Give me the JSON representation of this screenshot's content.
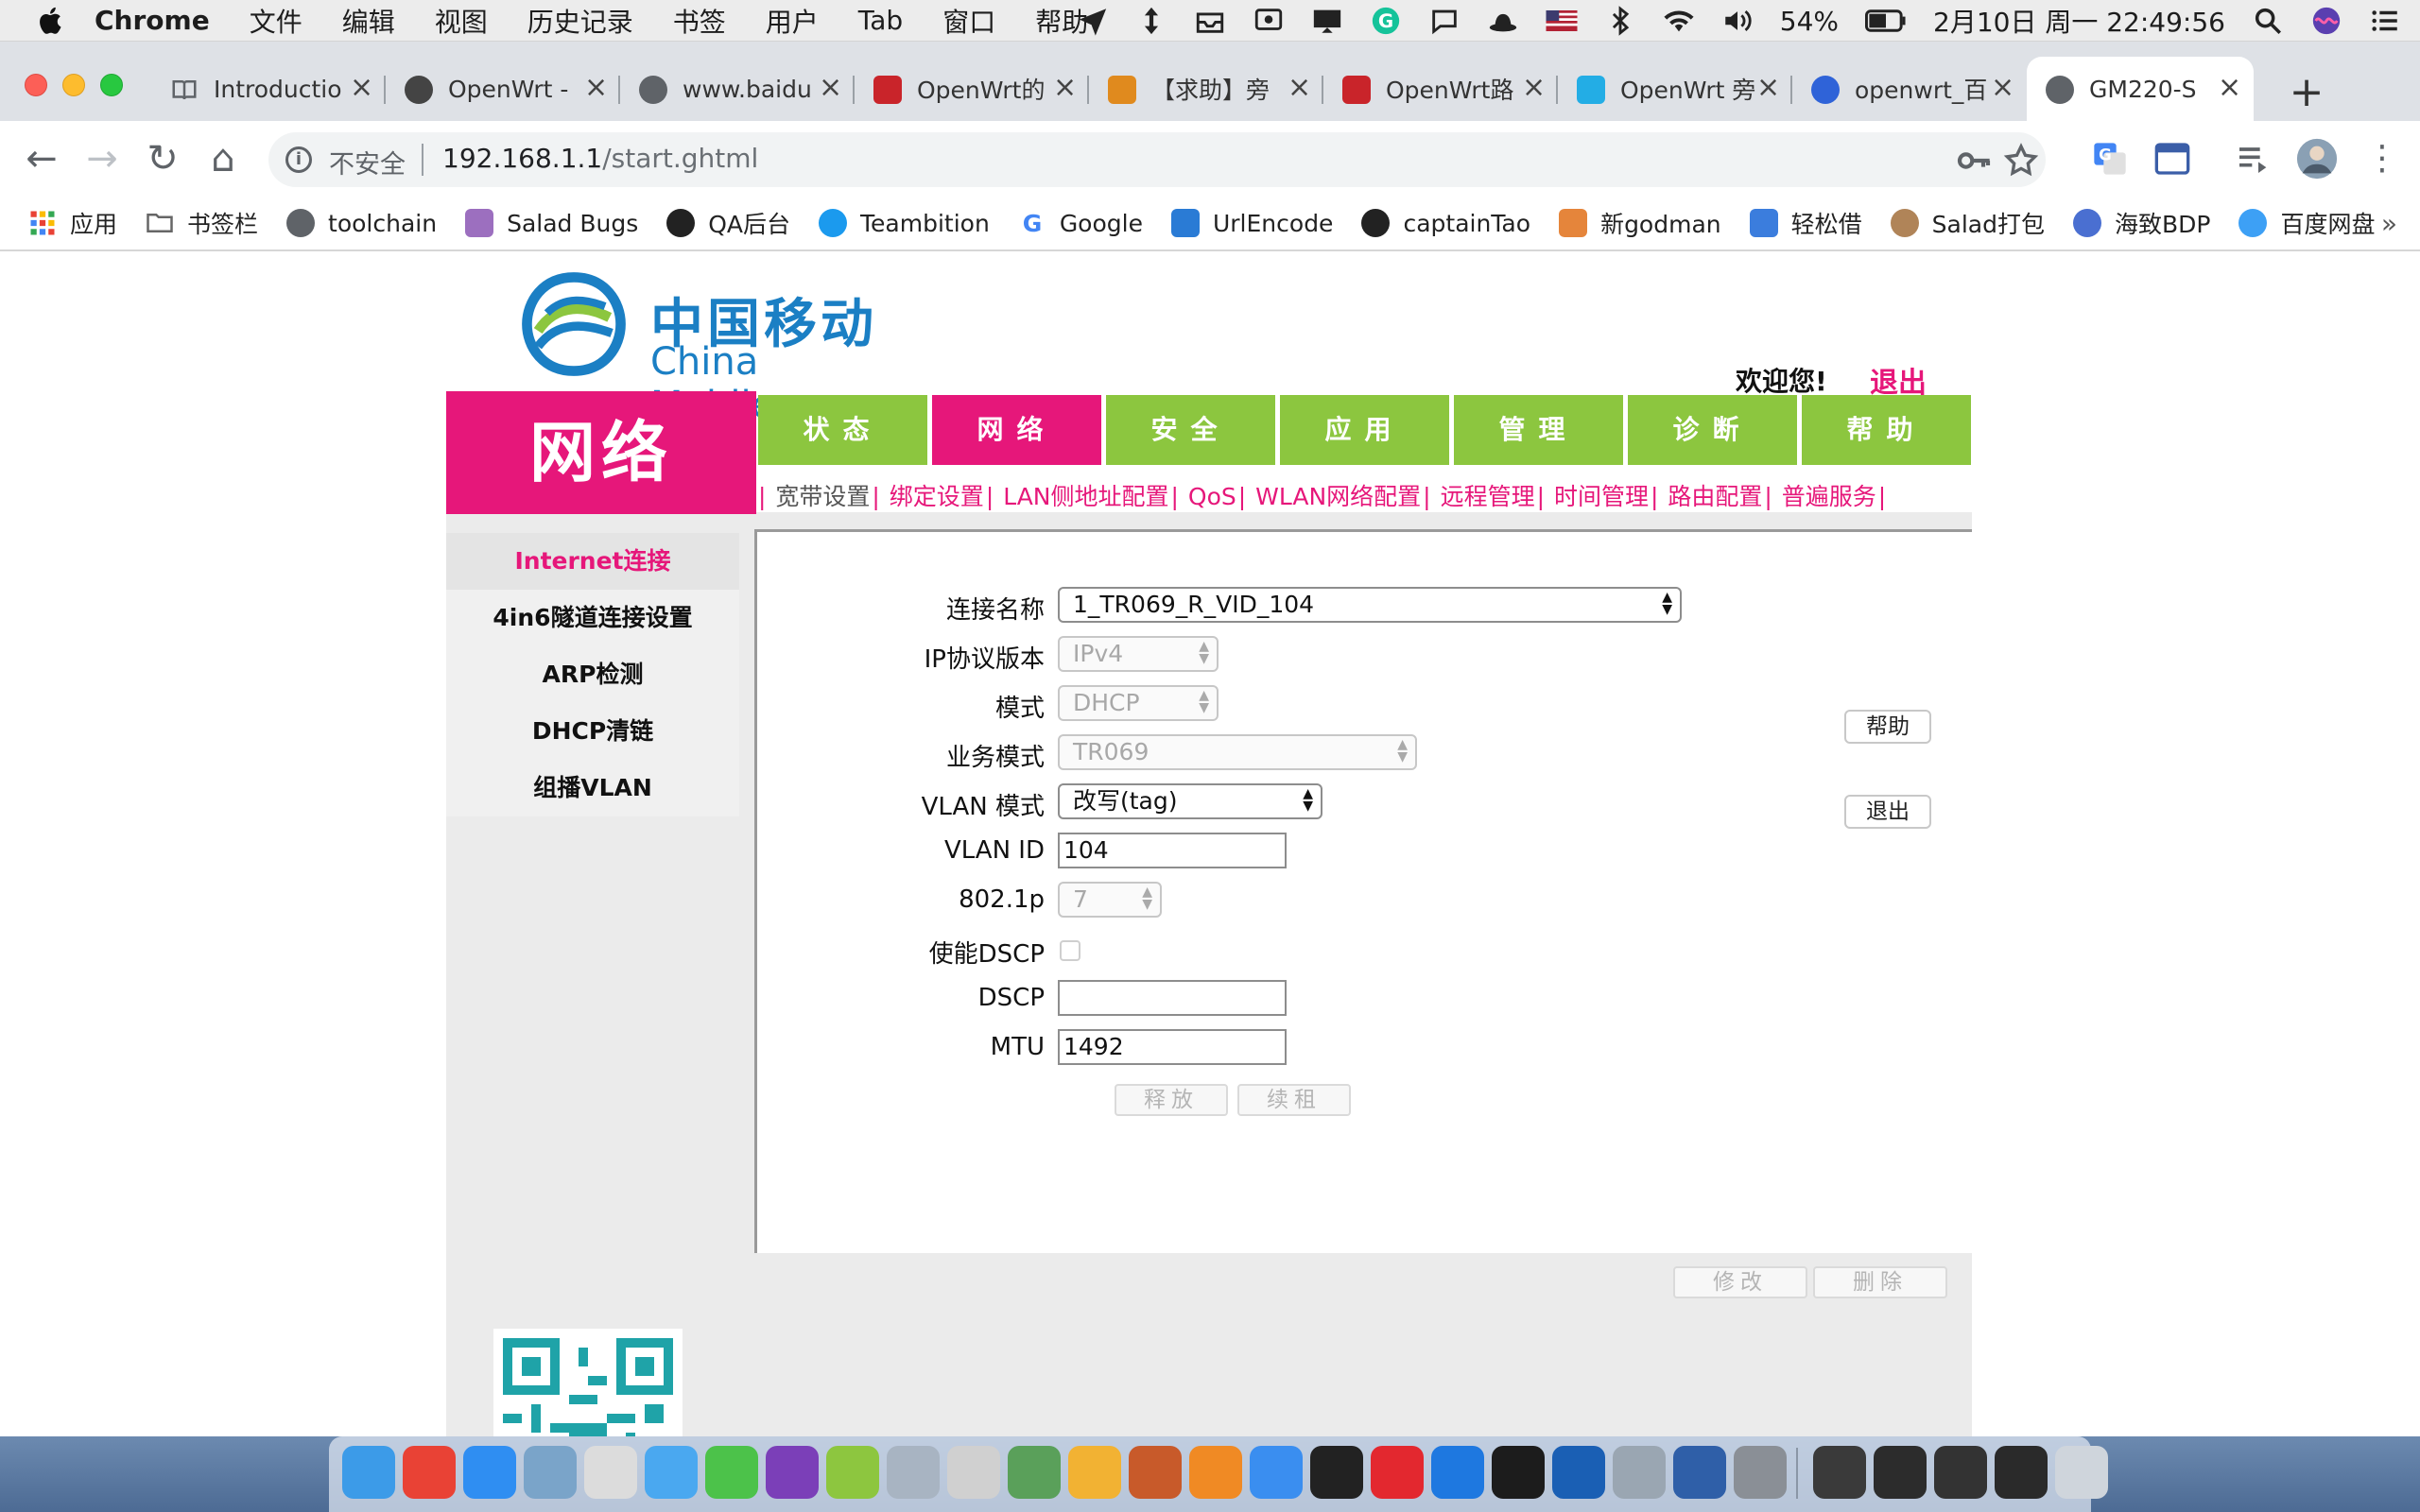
{
  "menubar": {
    "app_name": "Chrome",
    "menus": [
      "文件",
      "编辑",
      "视图",
      "历史记录",
      "书签",
      "用户",
      "Tab",
      "窗口",
      "帮助"
    ],
    "battery": "54%",
    "datetime": "2月10日 周一  22:49:56",
    "status_icons": [
      "send-icon",
      "updown-arrow-icon",
      "inbox-icon",
      "screenshot-icon",
      "screen-mirror-icon",
      "grammarly-icon",
      "chat-icon",
      "hat-icon",
      "us-flag-icon",
      "bluetooth-icon",
      "wifi-icon",
      "volume-icon",
      "battery-icon",
      "spotlight-icon",
      "siri-icon",
      "notification-list-icon"
    ]
  },
  "tabs": [
    {
      "title": "Introductio",
      "icon": "book-icon",
      "color": "#5f6368"
    },
    {
      "title": "OpenWrt -",
      "icon": "openwrt-icon",
      "color": "#444444"
    },
    {
      "title": "www.baidu",
      "icon": "globe-icon",
      "color": "#5f6368"
    },
    {
      "title": "OpenWrt的",
      "icon": "csdn-icon",
      "color": "#c9242a"
    },
    {
      "title": "【求助】旁",
      "icon": "forum-icon",
      "color": "#e08a1e"
    },
    {
      "title": "OpenWrt路",
      "icon": "csdn-icon",
      "color": "#c9242a"
    },
    {
      "title": "OpenWrt 旁",
      "icon": "bilibili-icon",
      "color": "#23ade5"
    },
    {
      "title": "openwrt_百",
      "icon": "baidu-paw-icon",
      "color": "#2f63d8"
    },
    {
      "title": "GM220-S",
      "icon": "globe-icon",
      "color": "#5f6368",
      "active": true
    }
  ],
  "address": {
    "security_text": "不安全",
    "url_host": "192.168.1.1",
    "url_path": "/start.ghtml"
  },
  "bookmarks": [
    {
      "label": "应用",
      "icon": "apps-grid-icon",
      "color": "#e94235"
    },
    {
      "label": "书签栏",
      "icon": "folder-icon",
      "color": "#777777"
    },
    {
      "label": "toolchain",
      "icon": "globe-icon",
      "color": "#5f6368"
    },
    {
      "label": "Salad Bugs",
      "icon": "salad-icon",
      "color": "#9c6fbf"
    },
    {
      "label": "QA后台",
      "icon": "qa-icon",
      "color": "#222222"
    },
    {
      "label": "Teambition",
      "icon": "teambition-icon",
      "color": "#1b9aee"
    },
    {
      "label": "Google",
      "icon": "google-icon",
      "color": "#4285f4"
    },
    {
      "label": "UrlEncode",
      "icon": "urlencode-icon",
      "color": "#2a7bd5"
    },
    {
      "label": "captainTao",
      "icon": "github-icon",
      "color": "#222222"
    },
    {
      "label": "新godman",
      "icon": "crab-icon",
      "color": "#e5853b"
    },
    {
      "label": "轻松借",
      "icon": "phone-icon",
      "color": "#3b7ddd"
    },
    {
      "label": "Salad打包",
      "icon": "avatar-icon",
      "color": "#b08458"
    },
    {
      "label": "海致BDP",
      "icon": "bdp-icon",
      "color": "#4a6fd1"
    },
    {
      "label": "百度网盘",
      "icon": "baidu-cloud-icon",
      "color": "#3da0f5"
    }
  ],
  "page": {
    "logo_cn": "中国移动",
    "logo_en": "China Mobile",
    "welcome": "欢迎您!",
    "logout": "退出",
    "section_title": "网络",
    "main_nav": [
      {
        "label": "状态"
      },
      {
        "label": "网络",
        "active": true
      },
      {
        "label": "安全"
      },
      {
        "label": "应用"
      },
      {
        "label": "管理"
      },
      {
        "label": "诊断"
      },
      {
        "label": "帮助"
      }
    ],
    "sub_nav": [
      "宽带设置",
      "绑定设置",
      "LAN侧地址配置",
      "QoS",
      "WLAN网络配置",
      "远程管理",
      "时间管理",
      "路由配置",
      "普遍服务"
    ],
    "sub_nav_current": 0,
    "sidebar": [
      {
        "label": "Internet连接",
        "active": true
      },
      {
        "label": "4in6隧道连接设置"
      },
      {
        "label": "ARP检测"
      },
      {
        "label": "DHCP清链"
      },
      {
        "label": "组播VLAN"
      }
    ],
    "form": {
      "connection_name_label": "连接名称",
      "connection_name_value": "1_TR069_R_VID_104",
      "ip_version_label": "IP协议版本",
      "ip_version_value": "IPv4",
      "mode_label": "模式",
      "mode_value": "DHCP",
      "service_mode_label": "业务模式",
      "service_mode_value": "TR069",
      "vlan_mode_label": "VLAN 模式",
      "vlan_mode_value": "改写(tag)",
      "vlan_id_label": "VLAN ID",
      "vlan_id_value": "104",
      "p8021_label": "802.1p",
      "p8021_value": "7",
      "dscp_enable_label": "使能DSCP",
      "dscp_enable_checked": false,
      "dscp_label": "DSCP",
      "dscp_value": "",
      "mtu_label": "MTU",
      "mtu_value": "1492",
      "release_button": "释放",
      "renew_button": "续租"
    },
    "help_button": "帮助",
    "exit_button": "退出",
    "modify_button": "修改",
    "delete_button": "删除"
  },
  "dock": [
    {
      "icon": "finder-icon",
      "color": "#3c9be8"
    },
    {
      "icon": "chrome-icon",
      "color": "#e94235"
    },
    {
      "icon": "safari-icon",
      "color": "#2f8ef2"
    },
    {
      "icon": "preview-icon",
      "color": "#7aa4c9"
    },
    {
      "icon": "cleaner-icon",
      "color": "#dcdcdc"
    },
    {
      "icon": "messages-icon",
      "color": "#4aa8f0"
    },
    {
      "icon": "wechat-icon",
      "color": "#4cc24a"
    },
    {
      "icon": "onenote-icon",
      "color": "#7b3fb8"
    },
    {
      "icon": "android-icon",
      "color": "#8dc63f"
    },
    {
      "icon": "launchpad-icon",
      "color": "#a8b4c2"
    },
    {
      "icon": "screenshot-app-icon",
      "color": "#d0d0d0"
    },
    {
      "icon": "android-studio-icon",
      "color": "#5aa05a"
    },
    {
      "icon": "photos-icon",
      "color": "#f2b233"
    },
    {
      "icon": "istat-icon",
      "color": "#c85a2a"
    },
    {
      "icon": "sublime-icon",
      "color": "#f08a24"
    },
    {
      "icon": "paw-icon",
      "color": "#3a8ef0"
    },
    {
      "icon": "terminal-dollar-icon",
      "color": "#222222"
    },
    {
      "icon": "youdao-icon",
      "color": "#e3282f"
    },
    {
      "icon": "remote-desktop-icon",
      "color": "#1e78e0"
    },
    {
      "icon": "terminal-icon",
      "color": "#1c1c1c"
    },
    {
      "icon": "quicktime-icon",
      "color": "#1a5fb4"
    },
    {
      "icon": "disk-utility-icon",
      "color": "#9aa6b2"
    },
    {
      "icon": "virtualbox-icon",
      "color": "#2f5fa8"
    },
    {
      "icon": "system-preferences-icon",
      "color": "#8a8f96"
    },
    {
      "icon": "window-thumb-icon",
      "color": "#3a3a3a"
    },
    {
      "icon": "window-thumb-icon",
      "color": "#2c2c2c"
    },
    {
      "icon": "window-thumb-icon",
      "color": "#333333"
    },
    {
      "icon": "window-thumb-icon",
      "color": "#2a2a2a"
    },
    {
      "icon": "trash-icon",
      "color": "#cfd5dc"
    }
  ]
}
